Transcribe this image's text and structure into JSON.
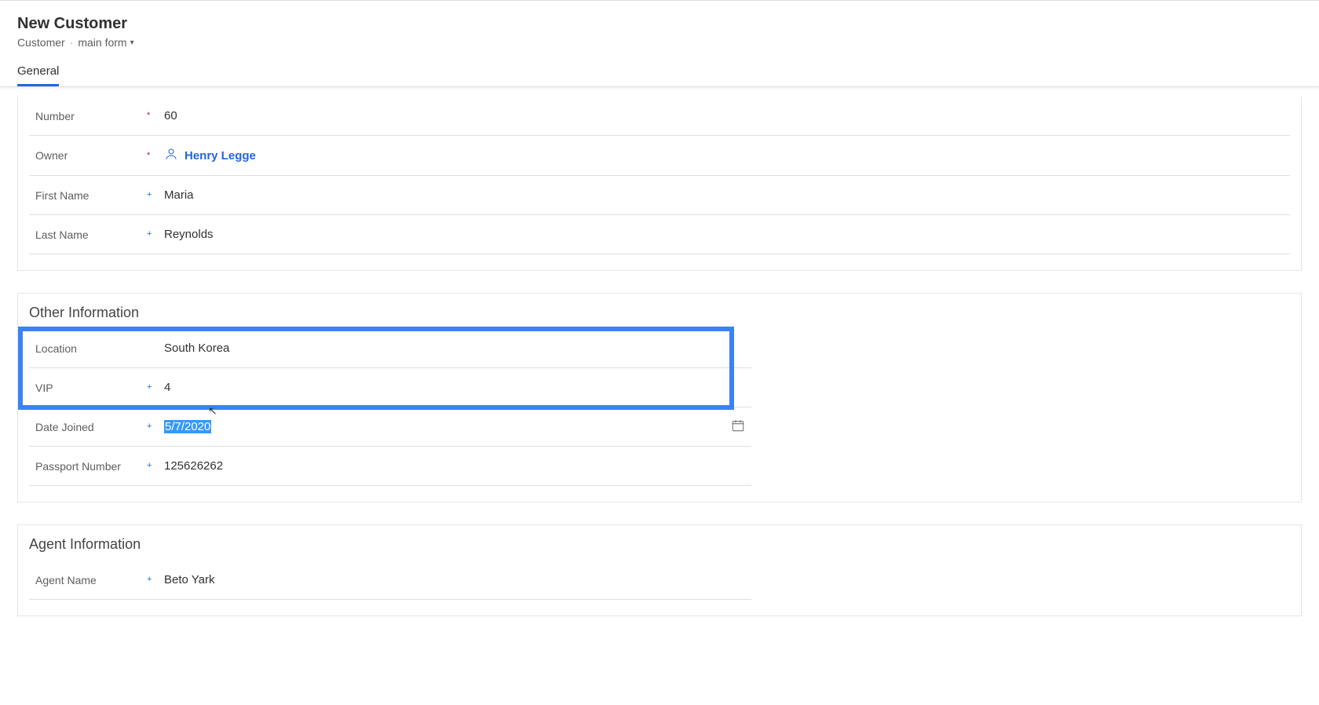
{
  "header": {
    "title": "New Customer",
    "entity": "Customer",
    "form_name": "main form"
  },
  "tabs": [
    {
      "label": "General",
      "active": true
    }
  ],
  "section1": {
    "fields": {
      "number": {
        "label": "Number",
        "value": "60",
        "required": "red"
      },
      "owner": {
        "label": "Owner",
        "value": "Henry Legge",
        "required": "red"
      },
      "first_name": {
        "label": "First Name",
        "value": "Maria",
        "required": "blue"
      },
      "last_name": {
        "label": "Last Name",
        "value": "Reynolds",
        "required": "blue"
      }
    }
  },
  "section2": {
    "title": "Other Information",
    "fields": {
      "location": {
        "label": "Location",
        "value": "South Korea",
        "required": ""
      },
      "vip": {
        "label": "VIP",
        "value": "4",
        "required": "blue"
      },
      "date_joined": {
        "label": "Date Joined",
        "value": "5/7/2020",
        "required": "blue"
      },
      "passport": {
        "label": "Passport Number",
        "value": "125626262",
        "required": "blue"
      }
    }
  },
  "section3": {
    "title": "Agent Information",
    "fields": {
      "agent_name": {
        "label": "Agent Name",
        "value": "Beto Yark",
        "required": "blue"
      }
    }
  }
}
